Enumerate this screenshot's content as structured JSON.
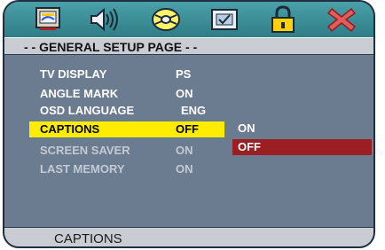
{
  "toolbar": {
    "icons": [
      "tv-display-icon",
      "speaker-audio-icon",
      "disc-video-icon",
      "preference-check-icon",
      "lock-password-icon",
      "close-exit-icon"
    ]
  },
  "page": {
    "title": "- - GENERAL SETUP PAGE - -"
  },
  "menu": {
    "items": [
      {
        "label": "TV DISPLAY",
        "value": "PS"
      },
      {
        "label": "ANGLE MARK",
        "value": "ON"
      },
      {
        "label": "OSD LANGUAGE",
        "value": "ENG"
      },
      {
        "label": "CAPTIONS",
        "value": "OFF"
      },
      {
        "label": "SCREEN SAVER",
        "value": "ON"
      },
      {
        "label": "LAST MEMORY",
        "value": "ON"
      }
    ]
  },
  "submenu": {
    "options": [
      "ON",
      "OFF"
    ]
  },
  "status": {
    "text": "CAPTIONS"
  },
  "colors": {
    "highlight": "#ffec00",
    "selected_option": "#9a1e22",
    "background": "#6c7c90",
    "toolbar": "#3a8f99"
  }
}
